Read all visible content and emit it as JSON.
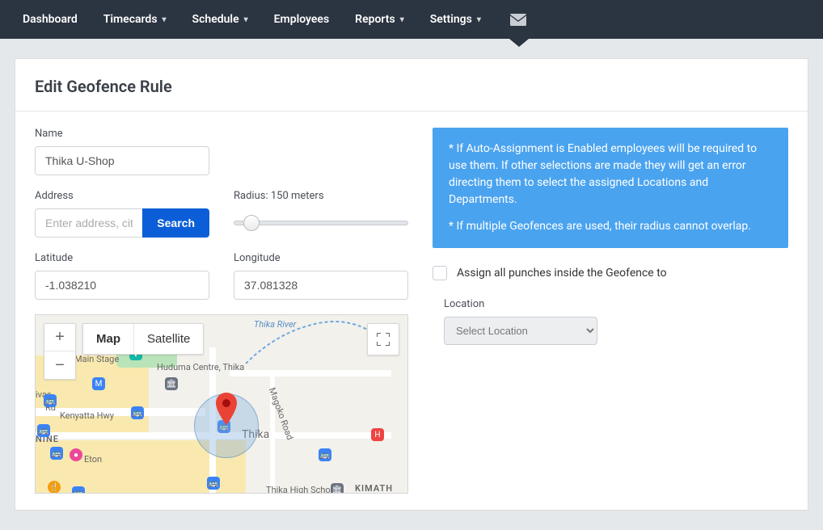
{
  "nav": {
    "items": [
      {
        "label": "Dashboard",
        "has_dropdown": false
      },
      {
        "label": "Timecards",
        "has_dropdown": true
      },
      {
        "label": "Schedule",
        "has_dropdown": true
      },
      {
        "label": "Employees",
        "has_dropdown": false
      },
      {
        "label": "Reports",
        "has_dropdown": true
      },
      {
        "label": "Settings",
        "has_dropdown": true
      }
    ]
  },
  "page": {
    "title": "Edit Geofence Rule"
  },
  "form": {
    "name": {
      "label": "Name",
      "value": "Thika U-Shop"
    },
    "address": {
      "label": "Address",
      "placeholder": "Enter address, city,",
      "search_button": "Search"
    },
    "radius": {
      "label_prefix": "Radius: ",
      "value": "150",
      "unit": "meters"
    },
    "latitude": {
      "label": "Latitude",
      "value": "-1.038210"
    },
    "longitude": {
      "label": "Longitude",
      "value": "37.081328"
    }
  },
  "map": {
    "type_map": "Map",
    "type_sat": "Satellite",
    "labels": {
      "main_stage": "Main Stage",
      "huduma": "Huduma Centre, Thika",
      "kenyatta": "Kenyatta Hwy",
      "thika_river": "Thika River",
      "thika": "Thika",
      "eton": "Eton",
      "nine": "NINE",
      "ivas": "ivas",
      "rd": "Rd",
      "magoko": "Magoko Road",
      "thika_high": "Thika High School",
      "kimathi": "KIMATH"
    }
  },
  "info": {
    "p1": "* If Auto-Assignment is Enabled employees will be required to use them. If other selections are made they will get an error directing them to select the assigned Locations and Departments.",
    "p2": "* If multiple Geofences are used, their radius cannot overlap."
  },
  "assign": {
    "checkbox_label": "Assign all punches inside the Geofence to",
    "location_label": "Location",
    "location_placeholder": "Select Location"
  }
}
